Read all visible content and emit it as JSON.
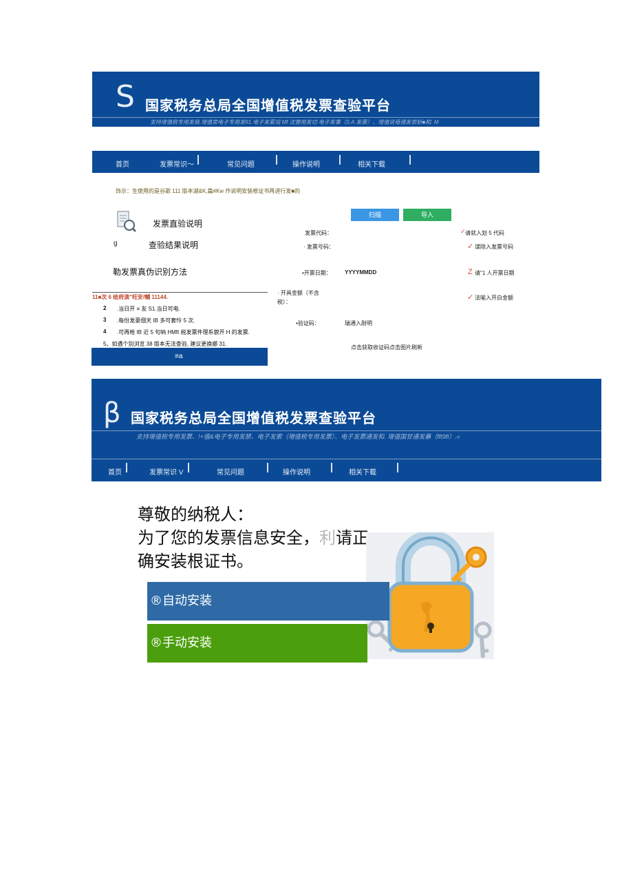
{
  "top": {
    "logo": "S",
    "title": "国家税务总局全国增值税发票查验平台",
    "subtitle": "支持增值税专用发装.增值荥电子专用发91.电子发累俎 Mf 沈营用发切.电子发事（S A 发票）、增值说母通发崇斩■和. M",
    "nav": [
      "首页",
      "发票常识～",
      "常见问题",
      "操作说明",
      "相关下载"
    ],
    "notice": "饰示：生使用的是谷歌 111 版本湖&K,篇#Kw 作说明安装根证书再进行发■的",
    "menu": [
      "发票直验说明",
      "查验结果说明",
      "勒发票真伪识别方法"
    ],
    "menu_g": "g",
    "tips_head": "11■次 6 给府滴\"旺安/輔 11144.",
    "tips": [
      {
        "num": "2",
        "text": ".当日开 ≡ 友 S1.当日可电."
      },
      {
        "num": "3",
        "text": ".每份发豪佃天 IB 多可套怜 5 次."
      },
      {
        "num": "4",
        "text": ".可再枪 IB 近 5 句呐 HMft 税发票件理系貌开 H 的发票."
      },
      {
        "num": "",
        "text": "5、如遇个别浏览 38 版本无法查验, 建议更换娜 31."
      }
    ],
    "footer_btn": "≡a",
    "scan_btn": "扫描",
    "import_btn": "导入",
    "form": {
      "code_label": "发票代码：",
      "code_hint": "请就入划 5 代码",
      "number_label": "· 发票号码：",
      "number_hint": "谍除入发票号码",
      "date_label": "•开票日期：",
      "date_value": "YYYYMMDD",
      "date_mark": "Z",
      "date_hint": "请\"1 人开票日期",
      "amount_label_1": "· 开具金额（不含",
      "amount_label_2": "税）：",
      "amount_hint": "法喻入开白金额",
      "verify_label": "•验证码：",
      "verify_value": "瑞通入耐明",
      "captcha_hint": "点击获取收证码点击图片刷新"
    }
  },
  "second": {
    "logo": "β",
    "title": "国家税务总局全国增值税发票查验平台",
    "subtitle": "支持增值税专用发票、!+值&电子专用发禁、电子发索（増值税专用发票）、电子发票通发和. 增值国甘通发暴（fft9fl）.«",
    "nav": [
      "首页",
      "发票常识 V",
      "常见问题",
      "操作说明",
      "相关下载"
    ],
    "greeting": "尊敬的纳税人：",
    "line1": "为了您的发票信息安全，",
    "line1_faint": "利",
    "line1_end": "请正",
    "line2": "确安装根证书。",
    "auto_install": "®自动安装",
    "manual_install": "®手动安装"
  },
  "colors": {
    "brand_blue": "#0b4a96",
    "scan_blue": "#3b97e3",
    "import_green": "#2fae62",
    "auto_blue": "#2f6aa6",
    "manual_green": "#4b9e0c",
    "lock_orange": "#f6a723"
  },
  "icons": [
    "document-search-icon",
    "checkmark-icon",
    "lock-icon",
    "key-icon"
  ]
}
